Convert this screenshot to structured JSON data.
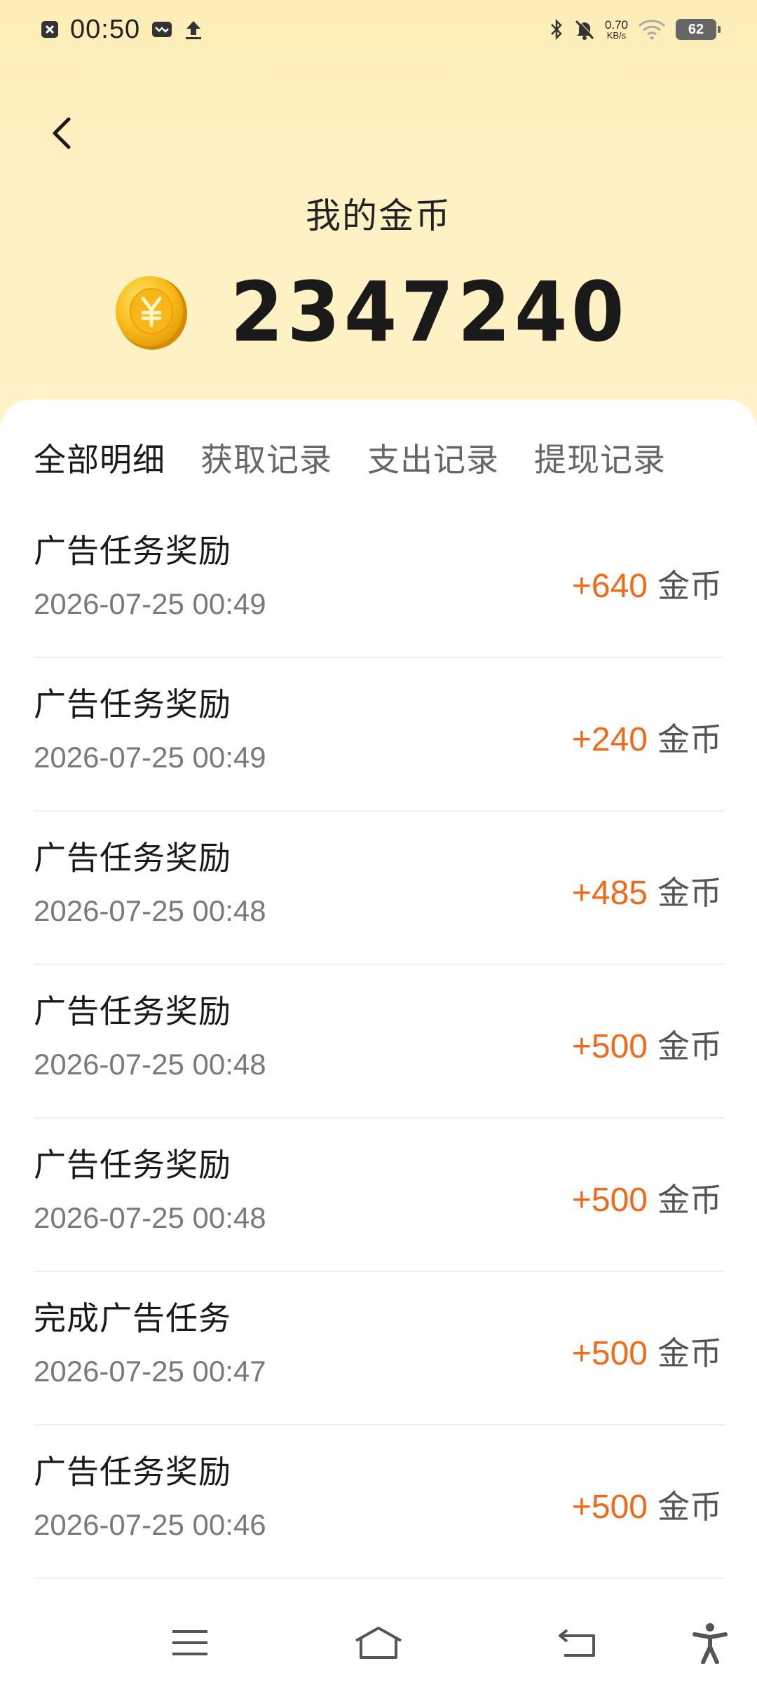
{
  "status_bar": {
    "time": "00:50",
    "net_speed_value": "0.70",
    "net_speed_unit": "KB/s",
    "battery": "62",
    "icons": [
      "notification-close-icon",
      "message-icon",
      "upload-icon",
      "bluetooth-icon",
      "mute-icon",
      "wifi-icon",
      "battery-icon"
    ]
  },
  "header": {
    "back_icon": "chevron-left-icon",
    "title": "我的金币",
    "coin_icon": "gold-coin-icon",
    "balance": "2347240"
  },
  "tabs": [
    {
      "label": "全部明细",
      "active": true
    },
    {
      "label": "获取记录",
      "active": false
    },
    {
      "label": "支出记录",
      "active": false
    },
    {
      "label": "提现记录",
      "active": false
    }
  ],
  "records": [
    {
      "title": "广告任务奖励",
      "time": "2026-07-25 00:49",
      "amount": "+640",
      "unit": "金币"
    },
    {
      "title": "广告任务奖励",
      "time": "2026-07-25 00:49",
      "amount": "+240",
      "unit": "金币"
    },
    {
      "title": "广告任务奖励",
      "time": "2026-07-25 00:48",
      "amount": "+485",
      "unit": "金币"
    },
    {
      "title": "广告任务奖励",
      "time": "2026-07-25 00:48",
      "amount": "+500",
      "unit": "金币"
    },
    {
      "title": "广告任务奖励",
      "time": "2026-07-25 00:48",
      "amount": "+500",
      "unit": "金币"
    },
    {
      "title": "完成广告任务",
      "time": "2026-07-25 00:47",
      "amount": "+500",
      "unit": "金币"
    },
    {
      "title": "广告任务奖励",
      "time": "2026-07-25 00:46",
      "amount": "+500",
      "unit": "金币"
    }
  ],
  "colors": {
    "header_bg": "#fef1c3",
    "amount": "#f06a1a",
    "coin": "#f5b817"
  },
  "nav_bar": {
    "icons": [
      "menu-icon",
      "home-icon",
      "back-icon",
      "accessibility-icon"
    ]
  }
}
